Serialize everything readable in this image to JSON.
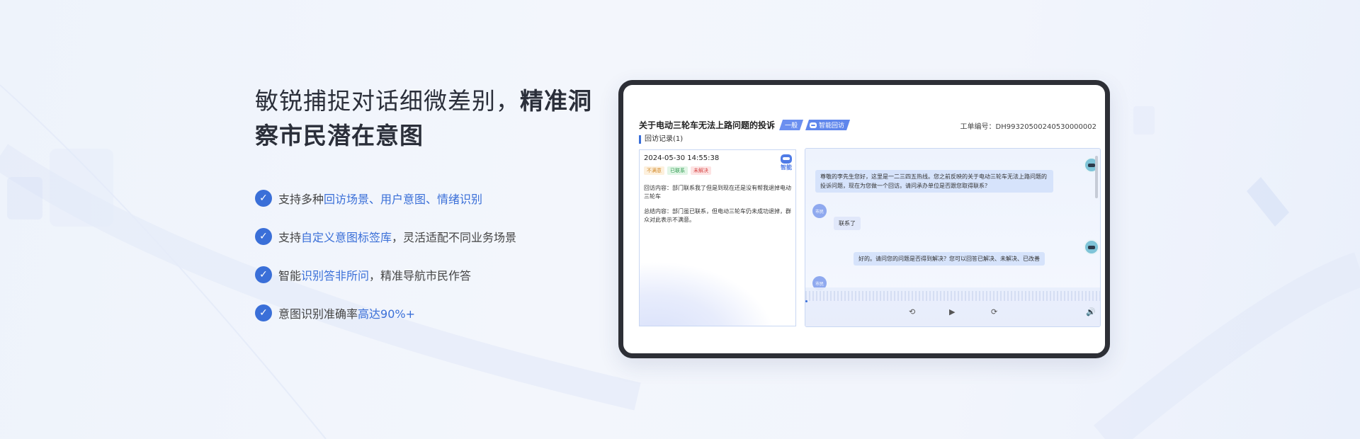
{
  "headline": {
    "normal": "敏锐捕捉对话细微差别，",
    "bold1": "精准洞",
    "bold2": "察市民潜在意图"
  },
  "features": [
    {
      "pre": "支持多种",
      "hl": "回访场景、用户意图、情绪识别",
      "post": ""
    },
    {
      "pre": "支持",
      "hl": "自定义意图标签库",
      "post": "，灵活适配不同业务场景"
    },
    {
      "pre": "智能",
      "hl": "识别答非所问",
      "post": "，精准导航市民作答"
    },
    {
      "pre": "意图识别准确率",
      "hl": "高达90%+",
      "post": ""
    }
  ],
  "device": {
    "title": "关于电动三轮车无法上路问题的投诉",
    "tag_plain": "一般",
    "tag_ai": "智能回访",
    "order_no": "工单编号：DH99320500240530000002",
    "record_label": "回访记录(1)",
    "record": {
      "time": "2024-05-30 14:55:38",
      "badges": [
        "不满意",
        "已联系",
        "未解决"
      ],
      "ai_label": "智能",
      "content": "回访内容：部门联系我了但是到现在还是没有帮我退掉电动三轮车",
      "summary": "总结内容：部门虽已联系，但电动三轮车仍未成功退掉，群众对此表示不满意。"
    },
    "chat": {
      "msg1": "尊敬的李先生您好，这里是一二三四五热线。您之前反映的关于电动三轮车无法上路问题的投诉问题，现在为您做一个回访。请问承办单位是否跟您取得联系？",
      "user_label": "市民",
      "msg2": "联系了",
      "msg3": "好的。请问您的问题是否得到解决？您可以回答已解决、未解决、已改善"
    }
  },
  "icons": {
    "check": "check-icon",
    "rewind": "rewind-icon",
    "play": "play-icon",
    "forward": "forward-icon",
    "volume": "volume-icon"
  },
  "colors": {
    "accent": "#3a6fd8",
    "frame": "#2d2f36"
  }
}
